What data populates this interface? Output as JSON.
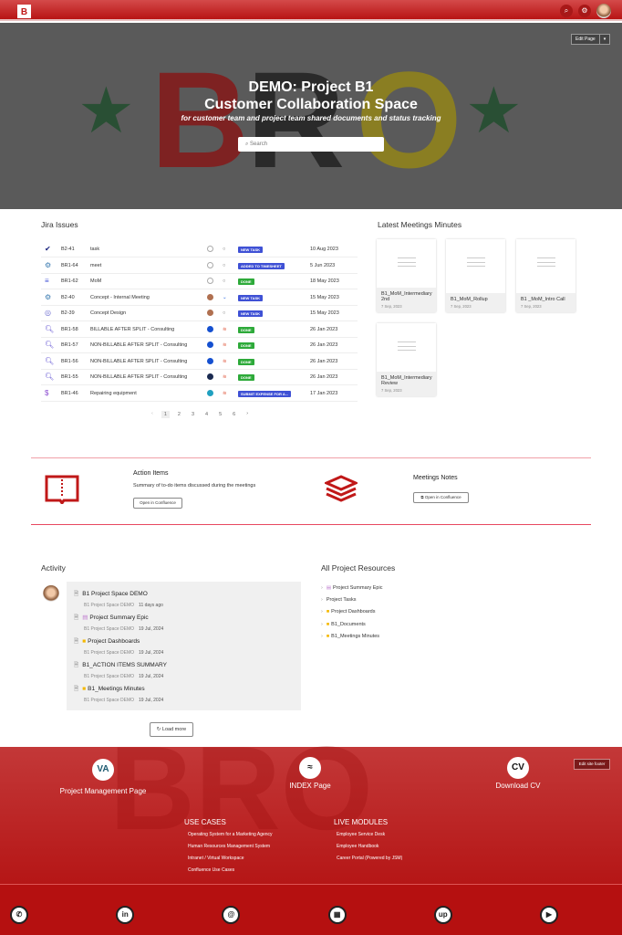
{
  "header": {
    "logo": "B",
    "search_icon": "search-icon",
    "settings_icon": "gear-icon"
  },
  "hero": {
    "title_line1": "DEMO: Project B1",
    "title_line2": "Customer Collaboration Space",
    "subtitle": "for customer team and project team shared documents and status tracking",
    "search_placeholder": "Search",
    "edit_page": "Edit Page",
    "bg_letters": "BRO"
  },
  "jira": {
    "title": "Jira Issues",
    "rows": [
      {
        "icon": "✔",
        "icon_color": "#1a237e",
        "key": "B2-41",
        "summary": "task",
        "assignee": "empty",
        "priority": "○",
        "status": "NEW TASK",
        "status_color": "#3f51d5",
        "date": "10 Aug 2023"
      },
      {
        "icon": "⚙",
        "icon_color": "#3a7ab0",
        "key": "BR1-64",
        "summary": "meet",
        "assignee": "empty",
        "priority": "○",
        "status": "ADDED TO TIMESHEET",
        "status_color": "#3f51d5",
        "date": "5 Jun 2023"
      },
      {
        "icon": "≡",
        "icon_color": "#3f51d5",
        "key": "BR1-62",
        "summary": "MoM",
        "assignee": "empty",
        "priority": "○",
        "status": "DONE",
        "status_color": "#2eaa3a",
        "date": "18 May 2023"
      },
      {
        "icon": "⚙",
        "icon_color": "#3a7ab0",
        "key": "B2-40",
        "summary": "Concept - Internal Meeting",
        "assignee": "photo",
        "priority": "⌄",
        "status": "NEW TASK",
        "status_color": "#3f51d5",
        "date": "15 May 2023"
      },
      {
        "icon": "◎",
        "icon_color": "#6a6ad0",
        "key": "B2-39",
        "summary": "Concept Design",
        "assignee": "photo",
        "priority": "○",
        "status": "NEW TASK",
        "status_color": "#3f51d5",
        "date": "15 May 2023"
      },
      {
        "icon": "🔍︎",
        "icon_color": "#5a4ad0",
        "key": "BR1-58",
        "summary": "BILLABLE AFTER SPLIT - Consulting",
        "assignee": "blue",
        "priority": "≋",
        "status": "DONE",
        "status_color": "#2eaa3a",
        "date": "26 Jan 2023"
      },
      {
        "icon": "🔍︎",
        "icon_color": "#5a4ad0",
        "key": "BR1-57",
        "summary": "NON-BILLABLE AFTER SPLIT - Consulting",
        "assignee": "blue",
        "priority": "≋",
        "status": "DONE",
        "status_color": "#2eaa3a",
        "date": "26 Jan 2023"
      },
      {
        "icon": "🔍︎",
        "icon_color": "#5a4ad0",
        "key": "BR1-56",
        "summary": "NON-BILLABLE AFTER SPLIT - Consulting",
        "assignee": "blue",
        "priority": "≋",
        "status": "DONE",
        "status_color": "#2eaa3a",
        "date": "26 Jan 2023"
      },
      {
        "icon": "🔍︎",
        "icon_color": "#5a4ad0",
        "key": "BR1-55",
        "summary": "NON-BILLABLE AFTER SPLIT - Consulting",
        "assignee": "navy",
        "priority": "≋",
        "status": "DONE",
        "status_color": "#2eaa3a",
        "date": "26 Jan 2023"
      },
      {
        "icon": "$",
        "icon_color": "#8a4ad0",
        "key": "BR1-46",
        "summary": "Repairing equipment",
        "assignee": "teal",
        "priority": "≋",
        "status": "SUBMIT EXPENSE FOR A...",
        "status_color": "#3f51d5",
        "date": "17 Jan 2023"
      }
    ],
    "pagination": {
      "prev": "‹",
      "pages": [
        "1",
        "2",
        "3",
        "4",
        "5",
        "6"
      ],
      "current": "1",
      "next": "›"
    }
  },
  "meetings": {
    "title": "Latest Meetings Minutes",
    "cards": [
      {
        "title": "B1_MoM_Intermediary 2nd",
        "date": "7 Sep, 2023"
      },
      {
        "title": "B1_MoM_Rollup",
        "date": "7 Sep, 2023"
      },
      {
        "title": "B1 _MoM_Intro Call",
        "date": "7 Sep, 2023"
      },
      {
        "title": "B1_MoM_Intermediary Review",
        "date": "7 Sep, 2023"
      }
    ]
  },
  "action_items": {
    "title": "Action Items",
    "description": "Summary of to-do items discussed during the meetings",
    "button": "Open in Confluence"
  },
  "meeting_notes": {
    "title": "Meetings Notes",
    "button": "Open in Confluence"
  },
  "activity": {
    "title": "Activity",
    "items": [
      {
        "title": "B1 Project Space DEMO",
        "space": "B1 Project Space DEMO",
        "time": "11 days ago",
        "prefix": ""
      },
      {
        "title": "Project Summary Epic",
        "space": "B1 Project Space DEMO",
        "time": "19 Jul, 2024",
        "prefix": "doc"
      },
      {
        "title": "Project Dashboards",
        "space": "B1 Project Space DEMO",
        "time": "19 Jul, 2024",
        "prefix": "folder"
      },
      {
        "title": "B1_ACTION ITEMS SUMMARY",
        "space": "B1 Project Space DEMO",
        "time": "19 Jul, 2024",
        "prefix": ""
      },
      {
        "title": "B1_Meetings Minutes",
        "space": "B1 Project Space DEMO",
        "time": "19 Jul, 2024",
        "prefix": "folder"
      }
    ],
    "load_more": "Load more"
  },
  "resources": {
    "title": "All Project Resources",
    "items": [
      {
        "label": "Project Summary Epic",
        "prefix": "doc"
      },
      {
        "label": "Project Tasks",
        "prefix": ""
      },
      {
        "label": "Project Dashboards",
        "prefix": "folder"
      },
      {
        "label": "B1_Documents",
        "prefix": "folder"
      },
      {
        "label": "B1_Meetings Minutes",
        "prefix": "folder"
      }
    ]
  },
  "footer": {
    "edit": "Edit site footer",
    "links": [
      {
        "label": "Project Management Page",
        "icon": "VA"
      },
      {
        "label": "INDEX Page",
        "icon": "≈"
      },
      {
        "label": "Download CV",
        "icon": "CV"
      }
    ],
    "use_cases": {
      "title": "USE CASES",
      "items": [
        "Operating System for a Marketing Agency",
        "Human Resources Management System",
        "Intranet / Virtual Workspace",
        "Confluence Use Cases"
      ]
    },
    "live_modules": {
      "title": "LIVE MODULES",
      "items": [
        "Employee Service Desk",
        "Employee Handbook",
        "Career Portal (Powered by JSM)"
      ]
    },
    "social": [
      {
        "name": "whatsapp-icon",
        "glyph": "✆"
      },
      {
        "name": "linkedin-icon",
        "glyph": "in"
      },
      {
        "name": "email-icon",
        "glyph": "@"
      },
      {
        "name": "calendar-icon",
        "glyph": "▦"
      },
      {
        "name": "upwork-icon",
        "glyph": "up"
      },
      {
        "name": "youtube-icon",
        "glyph": "▶"
      }
    ]
  },
  "colors": {
    "brand_red": "#b81414",
    "done": "#2eaa3a",
    "new_task": "#3f51d5"
  }
}
